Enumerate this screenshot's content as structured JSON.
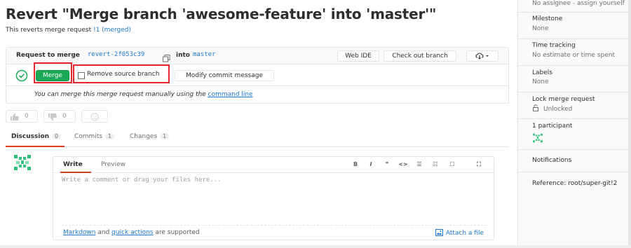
{
  "page": {
    "title": "Revert \"Merge branch 'awesome-feature' into 'master'\"",
    "subtitle_prefix": "This reverts merge request ",
    "subtitle_link": "!1",
    "subtitle_suffix": " (merged)"
  },
  "merge_widget": {
    "request_label": "Request to merge",
    "source_branch": "revert-2f053c39",
    "into_label": "into",
    "target_branch": "master",
    "web_ide_label": "Web IDE",
    "checkout_label": "Check out branch",
    "merge_label": "Merge",
    "remove_source_label": "Remove source branch",
    "modify_commit_label": "Modify commit message",
    "manual_note": "You can merge this merge request manually using the",
    "manual_link": "command line"
  },
  "awards": {
    "thumbs_up_count": "0",
    "thumbs_down_count": "0"
  },
  "tabs": [
    {
      "label": "Discussion",
      "count": "0"
    },
    {
      "label": "Commits",
      "count": "1"
    },
    {
      "label": "Changes",
      "count": "1"
    }
  ],
  "comment": {
    "write_tab": "Write",
    "preview_tab": "Preview",
    "placeholder": "Write a comment or drag your files here...",
    "markdown_link": "Markdown",
    "and_text": " and ",
    "quick_actions_link": "quick actions",
    "supported_text": " are supported",
    "attach_label": "Attach a file",
    "toolbar": [
      "B",
      "I",
      "❞",
      "<>",
      "☰",
      "☷",
      "☐",
      "⛶"
    ]
  },
  "sidebar": {
    "assignee_value": "No assignee - assign yourself",
    "milestone_title": "Milestone",
    "milestone_value": "None",
    "time_title": "Time tracking",
    "time_value": "No estimate or time spent",
    "labels_title": "Labels",
    "labels_value": "None",
    "lock_title": "Lock merge request",
    "lock_value": "Unlocked",
    "participants_title": "1 participant",
    "notifications_title": "Notifications",
    "reference_text": "Reference: root/super-git!2"
  },
  "colors": {
    "merge_green": "#1aaa55",
    "link_blue": "#1f78d1",
    "highlight_red": "#e8262d",
    "tab_active": "#db3b21"
  }
}
